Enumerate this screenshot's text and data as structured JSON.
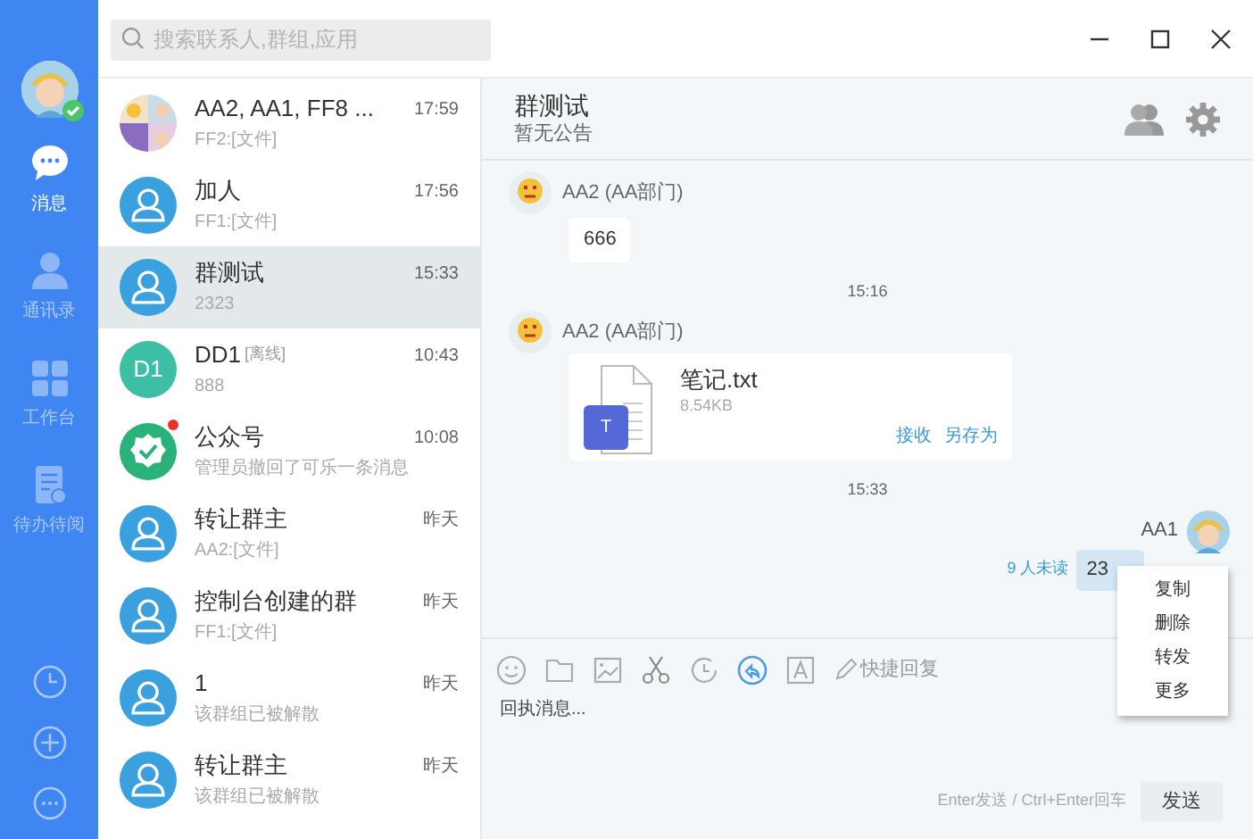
{
  "rail": {
    "items": [
      {
        "kind": "chat",
        "label": "消息",
        "selected": true
      },
      {
        "kind": "contacts",
        "label": "通讯录",
        "selected": false
      },
      {
        "kind": "apps",
        "label": "工作台",
        "selected": false
      },
      {
        "kind": "todo",
        "label": "待办待阅",
        "selected": false
      }
    ]
  },
  "search": {
    "placeholder": "搜索联系人,群组,应用"
  },
  "conversations": [
    {
      "kind": "collage",
      "name": "AA2, AA1, FF8 ...",
      "time": "17:59",
      "preview": "FF2:[文件]",
      "selected": false,
      "unread": false
    },
    {
      "kind": "person",
      "name": "加人",
      "time": "17:56",
      "preview": "FF1:[文件]",
      "selected": false,
      "unread": false
    },
    {
      "kind": "person",
      "name": "群测试",
      "time": "15:33",
      "preview": "2323",
      "selected": true,
      "unread": false
    },
    {
      "kind": "initials",
      "initials": "D1",
      "name": "DD1",
      "status": "[离线]",
      "time": "10:43",
      "preview": "888",
      "selected": false,
      "unread": false
    },
    {
      "kind": "official",
      "name": "公众号",
      "time": "10:08",
      "preview": "管理员撤回了可乐一条消息",
      "selected": false,
      "unread": true
    },
    {
      "kind": "person",
      "name": "转让群主",
      "time": "昨天",
      "preview": "AA2:[文件]",
      "selected": false,
      "unread": false
    },
    {
      "kind": "person",
      "name": "控制台创建的群",
      "time": "昨天",
      "preview": "FF1:[文件]",
      "selected": false,
      "unread": false
    },
    {
      "kind": "person",
      "name": "1",
      "time": "昨天",
      "preview": "该群组已被解散",
      "selected": false,
      "unread": false
    },
    {
      "kind": "person",
      "name": "转让群主",
      "time": "昨天",
      "preview": "该群组已被解散",
      "selected": false,
      "unread": false
    }
  ],
  "chat": {
    "title": "群测试",
    "notice": "暂无公告",
    "messages": [
      {
        "kind": "text",
        "sender": "AA2 (AA部门)",
        "text": "666"
      },
      {
        "kind": "time",
        "text": "15:16"
      },
      {
        "kind": "file",
        "sender": "AA2 (AA部门)",
        "file_name": "笔记.txt",
        "file_badge": "T",
        "size": "8.54KB",
        "actions": [
          "接收",
          "另存为"
        ]
      },
      {
        "kind": "time",
        "text": "15:33"
      },
      {
        "kind": "own",
        "sender": "AA1",
        "text": "23",
        "read_status": "9 人未读"
      }
    ],
    "context_menu": [
      "复制",
      "删除",
      "转发",
      "更多"
    ],
    "quick_reply": "快捷回复",
    "input": {
      "placeholder": "回执消息..."
    },
    "hint": "Enter发送 / Ctrl+Enter回车",
    "send": "发送"
  }
}
